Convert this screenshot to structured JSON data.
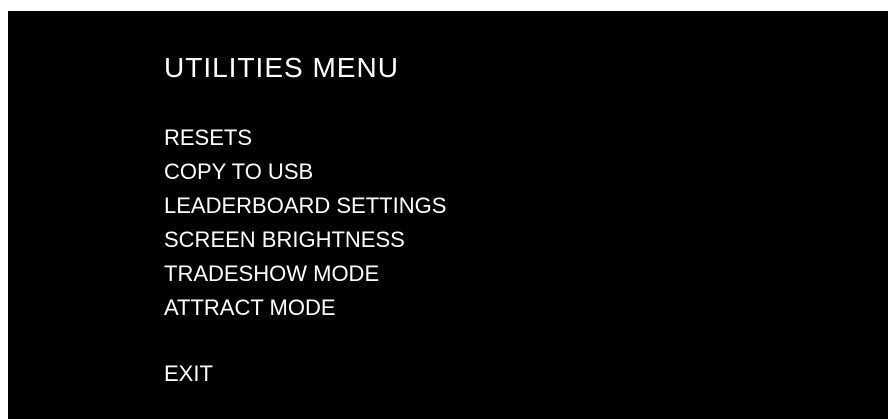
{
  "menu": {
    "title": "UTILITIES MENU",
    "items": [
      {
        "label": "RESETS"
      },
      {
        "label": "COPY TO USB"
      },
      {
        "label": "LEADERBOARD SETTINGS"
      },
      {
        "label": "SCREEN BRIGHTNESS"
      },
      {
        "label": "TRADESHOW MODE"
      },
      {
        "label": "ATTRACT MODE"
      }
    ],
    "exit_label": "EXIT"
  },
  "colors": {
    "background": "#000000",
    "text": "#ffffff",
    "page": "#ffffff"
  }
}
